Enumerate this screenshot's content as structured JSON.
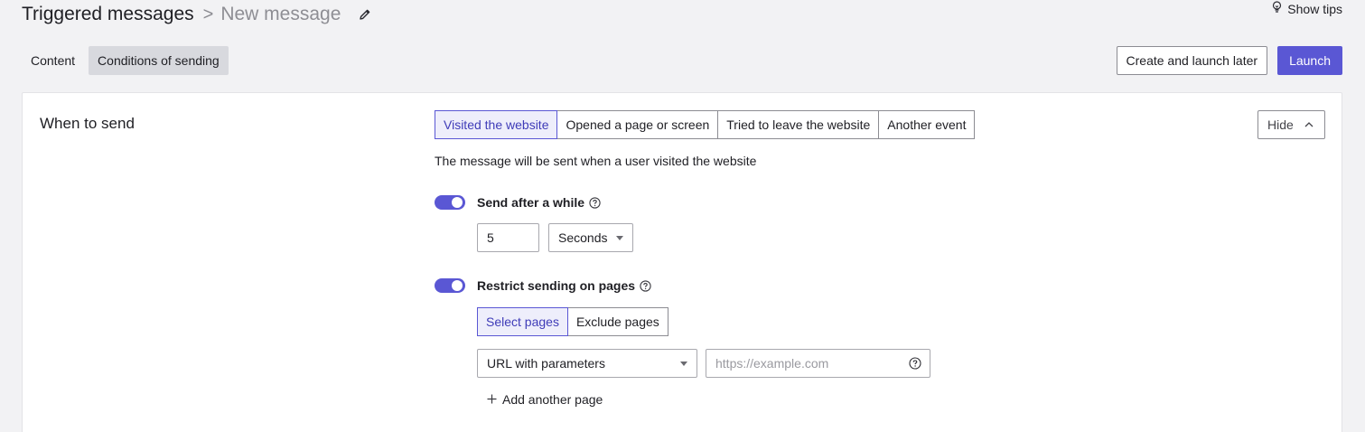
{
  "header": {
    "breadcrumb_root": "Triggered messages",
    "breadcrumb_separator": ">",
    "breadcrumb_current": "New message",
    "show_tips": "Show tips"
  },
  "tabs": [
    {
      "label": "Content",
      "active": false
    },
    {
      "label": "Conditions of sending",
      "active": true
    }
  ],
  "actions": {
    "create_later": "Create and launch later",
    "launch": "Launch"
  },
  "when_to_send": {
    "title": "When to send",
    "triggers": [
      {
        "label": "Visited the website",
        "active": true
      },
      {
        "label": "Opened a page or screen",
        "active": false
      },
      {
        "label": "Tried to leave the website",
        "active": false
      },
      {
        "label": "Another event",
        "active": false
      }
    ],
    "hide_label": "Hide",
    "description": "The message will be sent when a user visited the website",
    "send_after": {
      "label": "Send after a while",
      "enabled": true,
      "value": "5",
      "unit": "Seconds"
    },
    "restrict_pages": {
      "label": "Restrict sending on pages",
      "enabled": true,
      "modes": [
        {
          "label": "Select pages",
          "active": true
        },
        {
          "label": "Exclude pages",
          "active": false
        }
      ],
      "match_type": "URL with parameters",
      "url_placeholder": "https://example.com",
      "add_another": "Add another page"
    }
  },
  "colors": {
    "accent": "#5a57d4",
    "active_segment_bg": "#eeeefb",
    "page_bg": "#f2f2f4"
  },
  "icons": [
    "pencil-icon",
    "lightbulb-icon",
    "chevron-up-icon",
    "help-icon",
    "caret-down-icon",
    "plus-icon"
  ]
}
